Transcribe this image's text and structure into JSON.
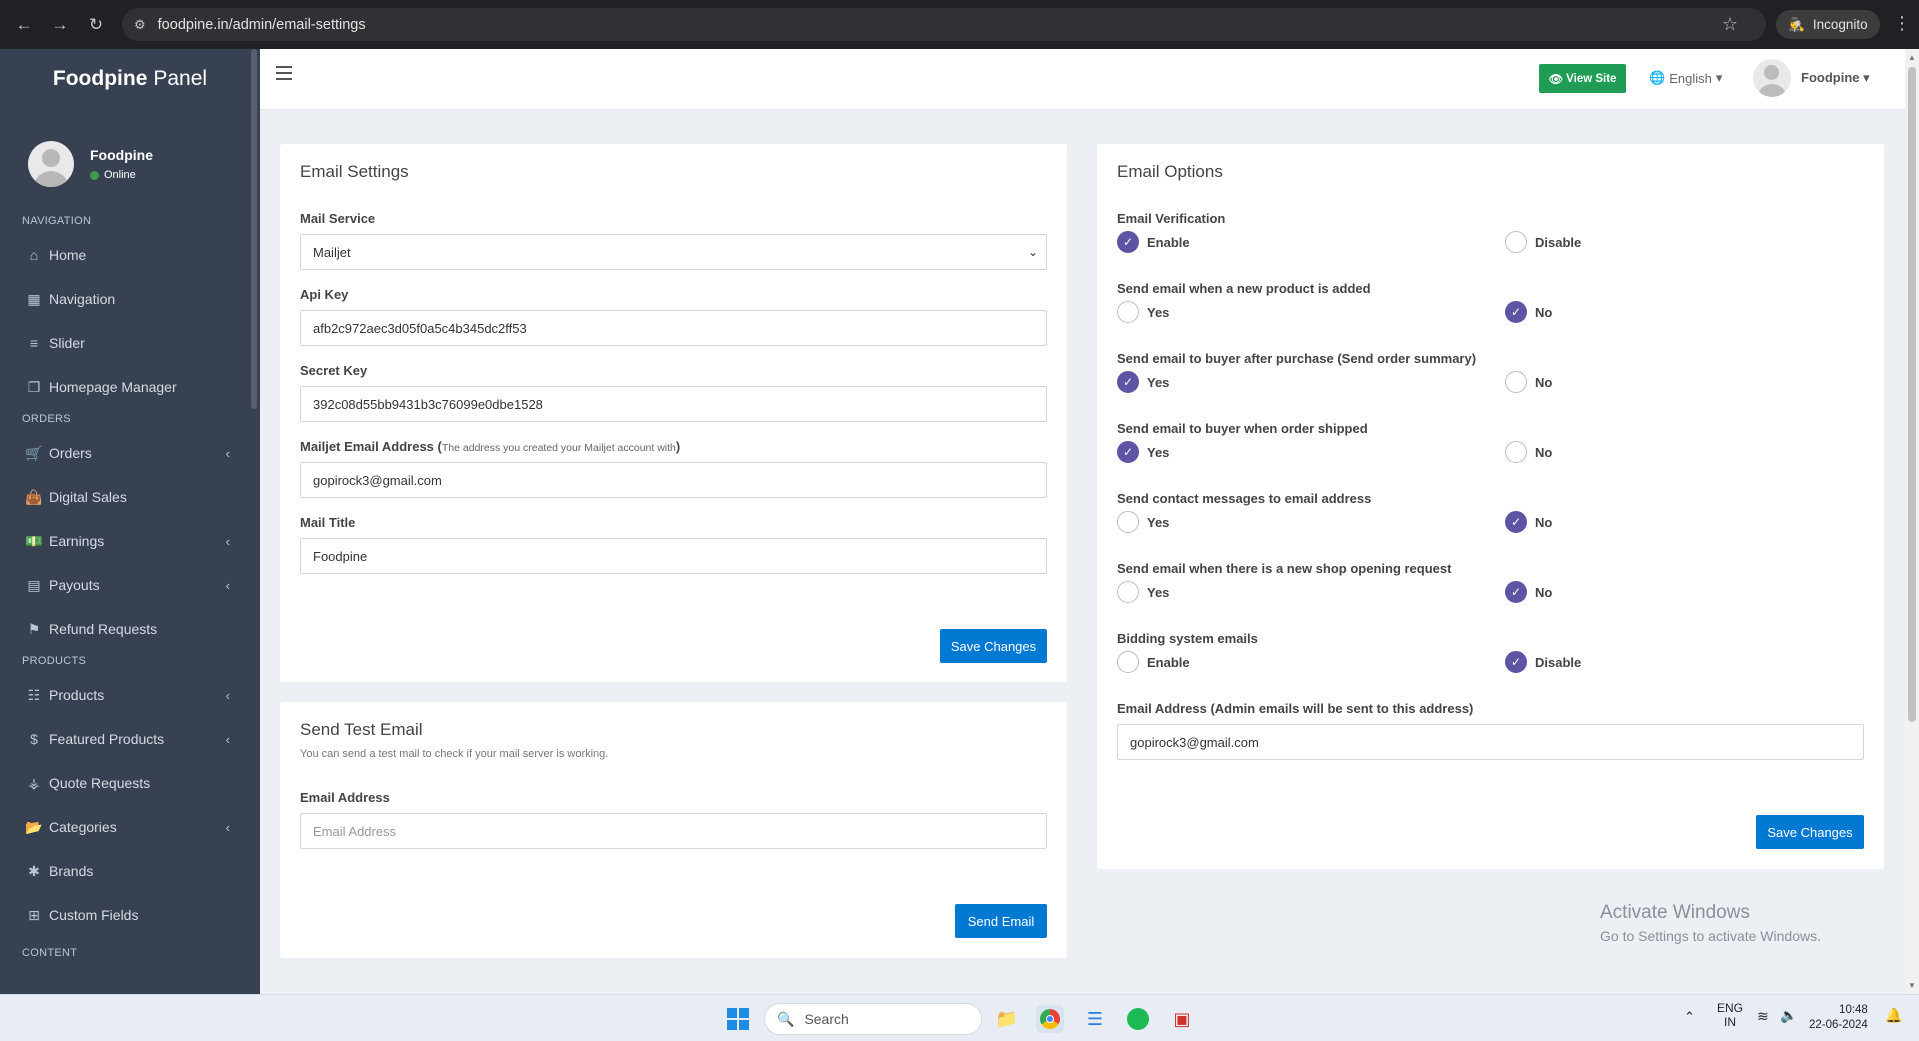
{
  "browser": {
    "url": "foodpine.in/admin/email-settings",
    "incognito_label": "Incognito"
  },
  "sidebar": {
    "brand_bold": "Foodpine",
    "brand_light": "Panel",
    "user_name": "Foodpine",
    "user_status": "Online",
    "sections": {
      "navigation": "NAVIGATION",
      "orders": "ORDERS",
      "products": "PRODUCTS",
      "content": "CONTENT"
    },
    "items": [
      {
        "label": "Home"
      },
      {
        "label": "Navigation"
      },
      {
        "label": "Slider"
      },
      {
        "label": "Homepage Manager"
      },
      {
        "label": "Orders"
      },
      {
        "label": "Digital Sales"
      },
      {
        "label": "Earnings"
      },
      {
        "label": "Payouts"
      },
      {
        "label": "Refund Requests"
      },
      {
        "label": "Products"
      },
      {
        "label": "Featured Products"
      },
      {
        "label": "Quote Requests"
      },
      {
        "label": "Categories"
      },
      {
        "label": "Brands"
      },
      {
        "label": "Custom Fields"
      }
    ]
  },
  "topbar": {
    "view_site": "View Site",
    "language": "English",
    "user": "Foodpine"
  },
  "email_settings": {
    "title": "Email Settings",
    "mail_service_label": "Mail Service",
    "mail_service_value": "Mailjet",
    "api_key_label": "Api Key",
    "api_key_value": "afb2c972aec3d05f0a5c4b345dc2ff53",
    "secret_key_label": "Secret Key",
    "secret_key_value": "392c08d55bb9431b3c76099e0dbe1528",
    "mailjet_email_label": "Mailjet Email Address",
    "mailjet_email_hint": "The address you created your Mailjet account with",
    "mailjet_email_value": "gopirock3@gmail.com",
    "mail_title_label": "Mail Title",
    "mail_title_value": "Foodpine",
    "save_button": "Save Changes"
  },
  "send_test": {
    "title": "Send Test Email",
    "subtitle": "You can send a test mail to check if your mail server is working.",
    "email_label": "Email Address",
    "email_placeholder": "Email Address",
    "send_button": "Send Email"
  },
  "email_options": {
    "title": "Email Options",
    "options": [
      {
        "label": "Email Verification",
        "a": "Enable",
        "b": "Disable",
        "selected": "a"
      },
      {
        "label": "Send email when a new product is added",
        "a": "Yes",
        "b": "No",
        "selected": "b"
      },
      {
        "label": "Send email to buyer after purchase (Send order summary)",
        "a": "Yes",
        "b": "No",
        "selected": "a"
      },
      {
        "label": "Send email to buyer when order shipped",
        "a": "Yes",
        "b": "No",
        "selected": "a"
      },
      {
        "label": "Send contact messages to email address",
        "a": "Yes",
        "b": "No",
        "selected": "b"
      },
      {
        "label": "Send email when there is a new shop opening request",
        "a": "Yes",
        "b": "No",
        "selected": "b"
      },
      {
        "label": "Bidding system emails",
        "a": "Enable",
        "b": "Disable",
        "selected": "b"
      }
    ],
    "admin_email_label": "Email Address (Admin emails will be sent to this address)",
    "admin_email_value": "gopirock3@gmail.com",
    "save_button": "Save Changes"
  },
  "watermark": {
    "line1": "Activate Windows",
    "line2": "Go to Settings to activate Windows."
  },
  "taskbar": {
    "search_placeholder": "Search",
    "lang_top": "ENG",
    "lang_bottom": "IN",
    "time": "10:48",
    "date": "22-06-2024"
  },
  "colors": {
    "sidebar_bg": "#374151",
    "accent_blue": "#0079d3",
    "view_site_green": "#1f9d55",
    "radio_checked": "#5d54a4"
  }
}
